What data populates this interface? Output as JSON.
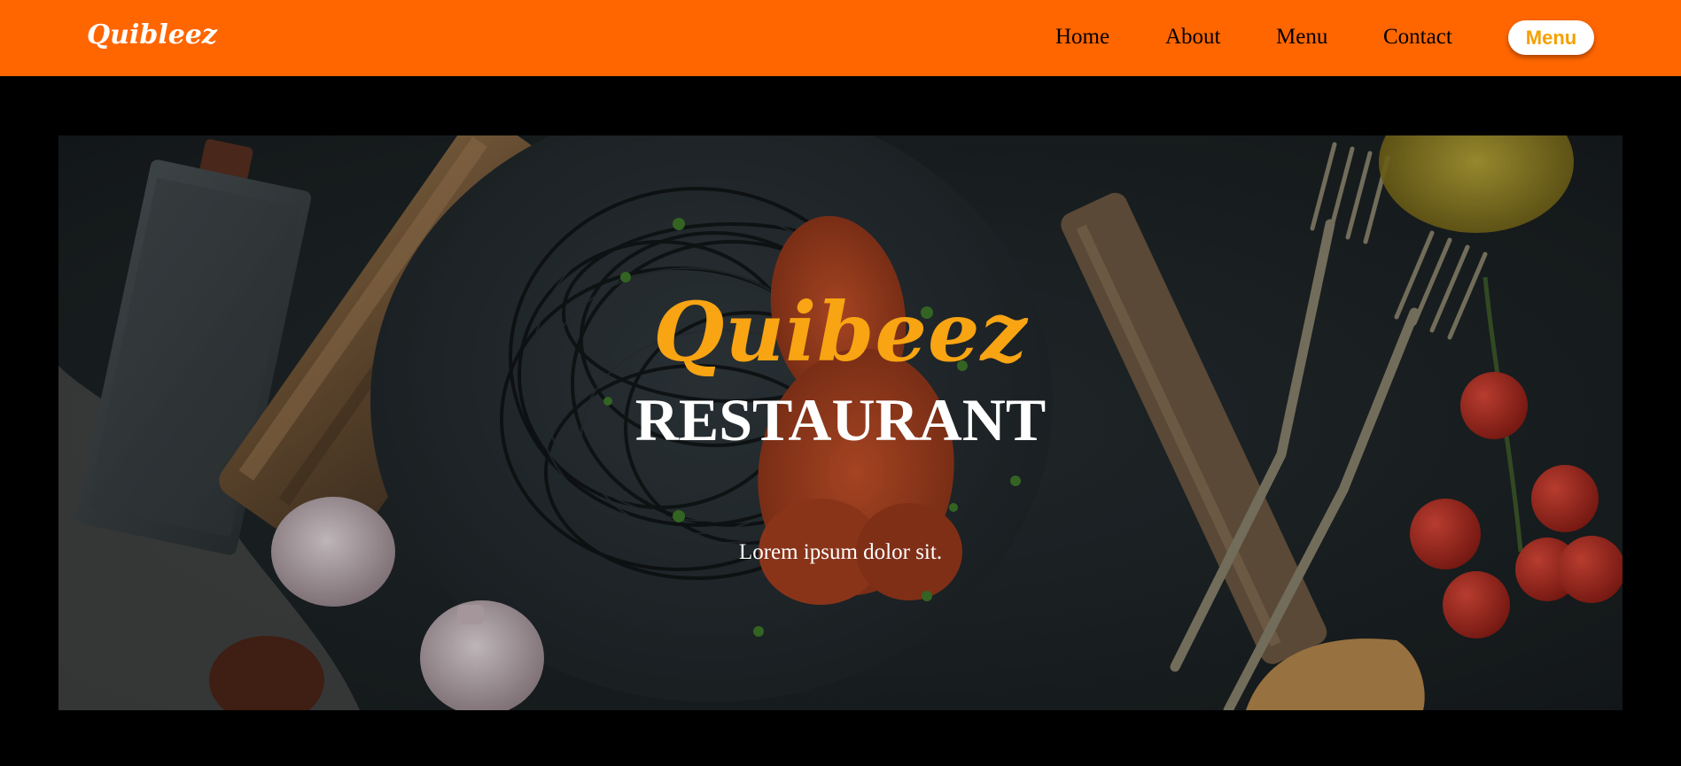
{
  "header": {
    "brand": "Quibleez",
    "nav": [
      {
        "label": "Home"
      },
      {
        "label": "About"
      },
      {
        "label": "Menu"
      },
      {
        "label": "Contact"
      }
    ],
    "menu_button": "Menu"
  },
  "hero": {
    "title": "Quibeez",
    "subtitle": "RESTAURANT",
    "tagline": "Lorem ipsum dolor sit."
  },
  "colors": {
    "navbar": "#ff6600",
    "accent": "#f8a413",
    "background": "#000000"
  }
}
